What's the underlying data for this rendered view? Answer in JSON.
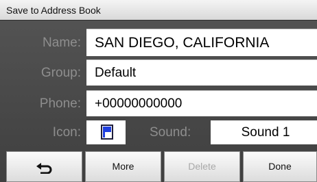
{
  "title": "Save to Address Book",
  "fields": {
    "name": {
      "label": "Name:",
      "value": "SAN DIEGO, CALIFORNIA"
    },
    "group": {
      "label": "Group:",
      "value": "Default"
    },
    "phone": {
      "label": "Phone:",
      "value": "+00000000000"
    }
  },
  "icon": {
    "label": "Icon:",
    "icon_name": "blue-flag-icon"
  },
  "sound": {
    "label": "Sound:",
    "value": "Sound 1"
  },
  "buttons": {
    "back_icon": "back-arrow-icon",
    "more": "More",
    "delete": "Delete",
    "done": "Done"
  }
}
